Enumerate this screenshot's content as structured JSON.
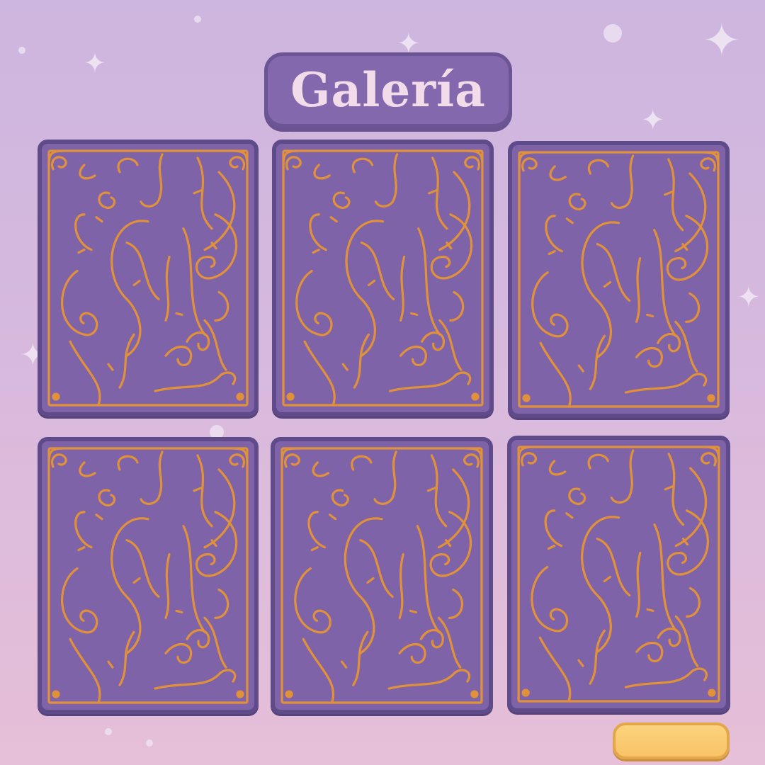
{
  "screen": {
    "title": "Galería"
  },
  "cards": [
    {
      "label": "",
      "face": "down"
    },
    {
      "label": "",
      "face": "down"
    },
    {
      "label": "",
      "face": "down"
    },
    {
      "label": "",
      "face": "down"
    },
    {
      "label": "",
      "face": "down"
    },
    {
      "label": "",
      "face": "down"
    }
  ],
  "next_button": {
    "label": ""
  },
  "colors": {
    "background_top": "#cdb6df",
    "background_bottom": "#e6bfd8",
    "plate": "#8468ad",
    "card_back": "#7f63a8",
    "card_border": "#5f4a8a",
    "ornament": "#e0913a",
    "title_text": "#f2dcea",
    "button": "#f8c466"
  },
  "icons": [
    "sparkle-icon",
    "card-back-ornament"
  ]
}
